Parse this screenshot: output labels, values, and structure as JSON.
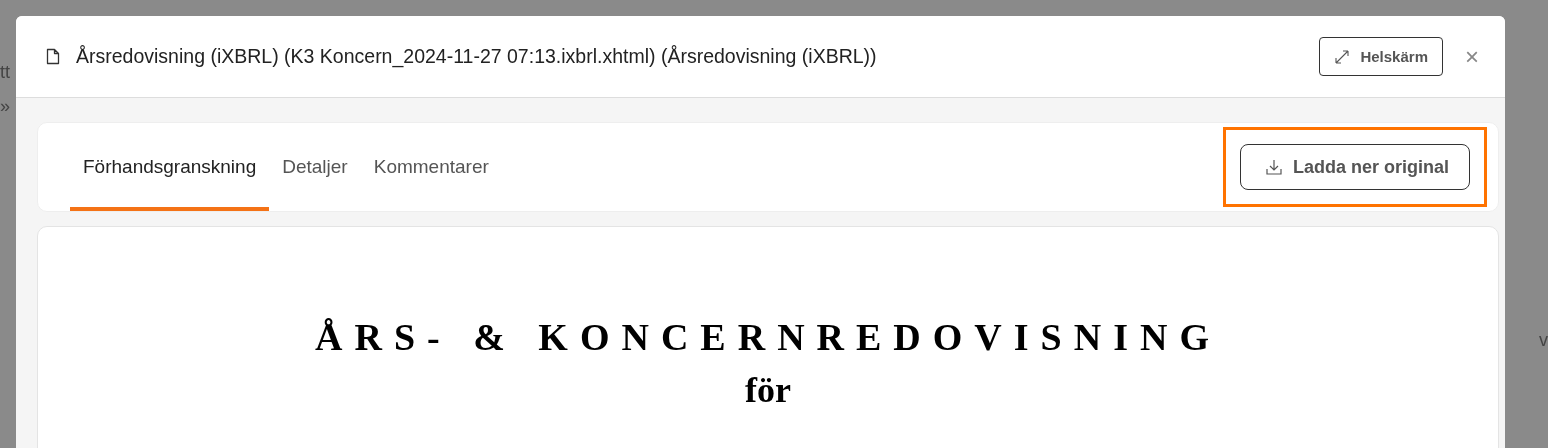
{
  "background": {
    "fragments": [
      "tt",
      "»",
      "v"
    ]
  },
  "modal": {
    "title": "Årsredovisning (iXBRL) (K3 Koncern_2024-11-27 07:13.ixbrl.xhtml) (Årsredovisning (iXBRL))",
    "fullscreen_button": "Helskärm",
    "close": "×"
  },
  "tabs": [
    {
      "label": "Förhandsgranskning",
      "selected": true
    },
    {
      "label": "Detaljer",
      "selected": false
    },
    {
      "label": "Kommentarer",
      "selected": false
    }
  ],
  "download_button": {
    "label": "Ladda ner original",
    "highlighted": true
  },
  "document": {
    "heading": "ÅRS- & KONCERNREDOVISNING",
    "subheading": "för"
  }
}
